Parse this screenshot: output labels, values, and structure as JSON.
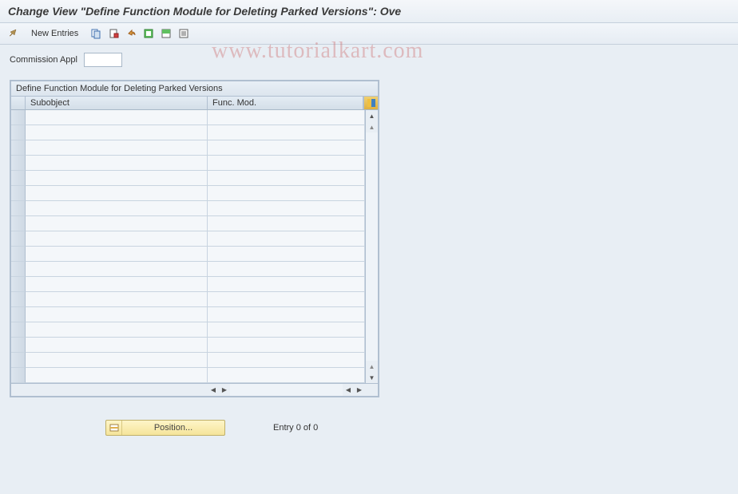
{
  "title": "Change View \"Define Function Module for Deleting Parked Versions\": Ove",
  "toolbar": {
    "new_entries_label": "New Entries"
  },
  "field": {
    "commission_appl_label": "Commission Appl",
    "commission_appl_value": ""
  },
  "table": {
    "title": "Define Function Module for Deleting Parked Versions",
    "columns": {
      "subobject": "Subobject",
      "func_mod": "Func. Mod."
    },
    "row_count": 18
  },
  "footer": {
    "position_label": "Position...",
    "entry_text": "Entry 0 of 0"
  },
  "watermark": "www.tutorialkart.com"
}
